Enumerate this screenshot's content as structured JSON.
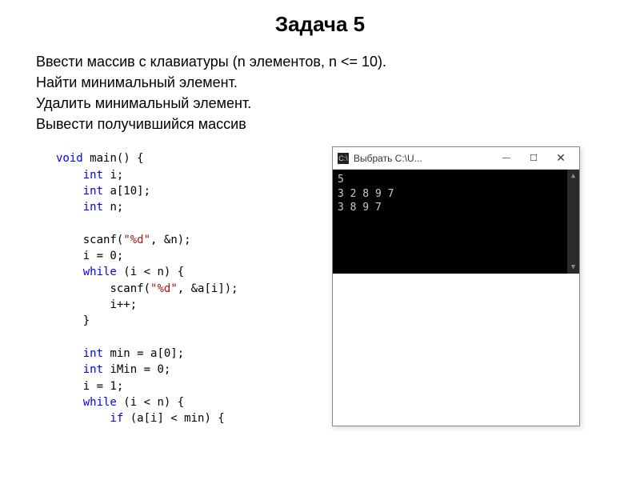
{
  "title": "Задача 5",
  "task": {
    "l1": "Ввести массив с клавиатуры (n элементов, n <= 10).",
    "l2": "Найти минимальный элемент.",
    "l3": "Удалить минимальный элемент.",
    "l4": "Вывести получившийся массив"
  },
  "code": {
    "kw_void": "void",
    "name_main": "main",
    "kw_int": "int",
    "var_i": "i;",
    "var_a": "a[10];",
    "var_n": "n;",
    "fn_scanf1": "scanf",
    "scanf1_args_open": "(",
    "scanf1_fmt": "\"%d\"",
    "scanf1_rest": ", &n);",
    "assign_i0": "i = 0;",
    "kw_while": "while",
    "while1_cond": " (i < n) {",
    "scanf2_fmt": "\"%d\"",
    "scanf2_rest": ", &a[i]);",
    "incr_i": "i++;",
    "close_brace": "}",
    "decl_min": " min = a[0];",
    "decl_imin": " iMin = 0;",
    "assign_i1": "i = 1;",
    "while2_cond": " (i < n) {",
    "kw_if": "if",
    "if_cond": " (a[i] < min) {"
  },
  "console": {
    "window_title": "Выбрать C:\\U...",
    "lines": [
      "5",
      "3 2 8 9 7",
      "3 8 9 7"
    ]
  }
}
